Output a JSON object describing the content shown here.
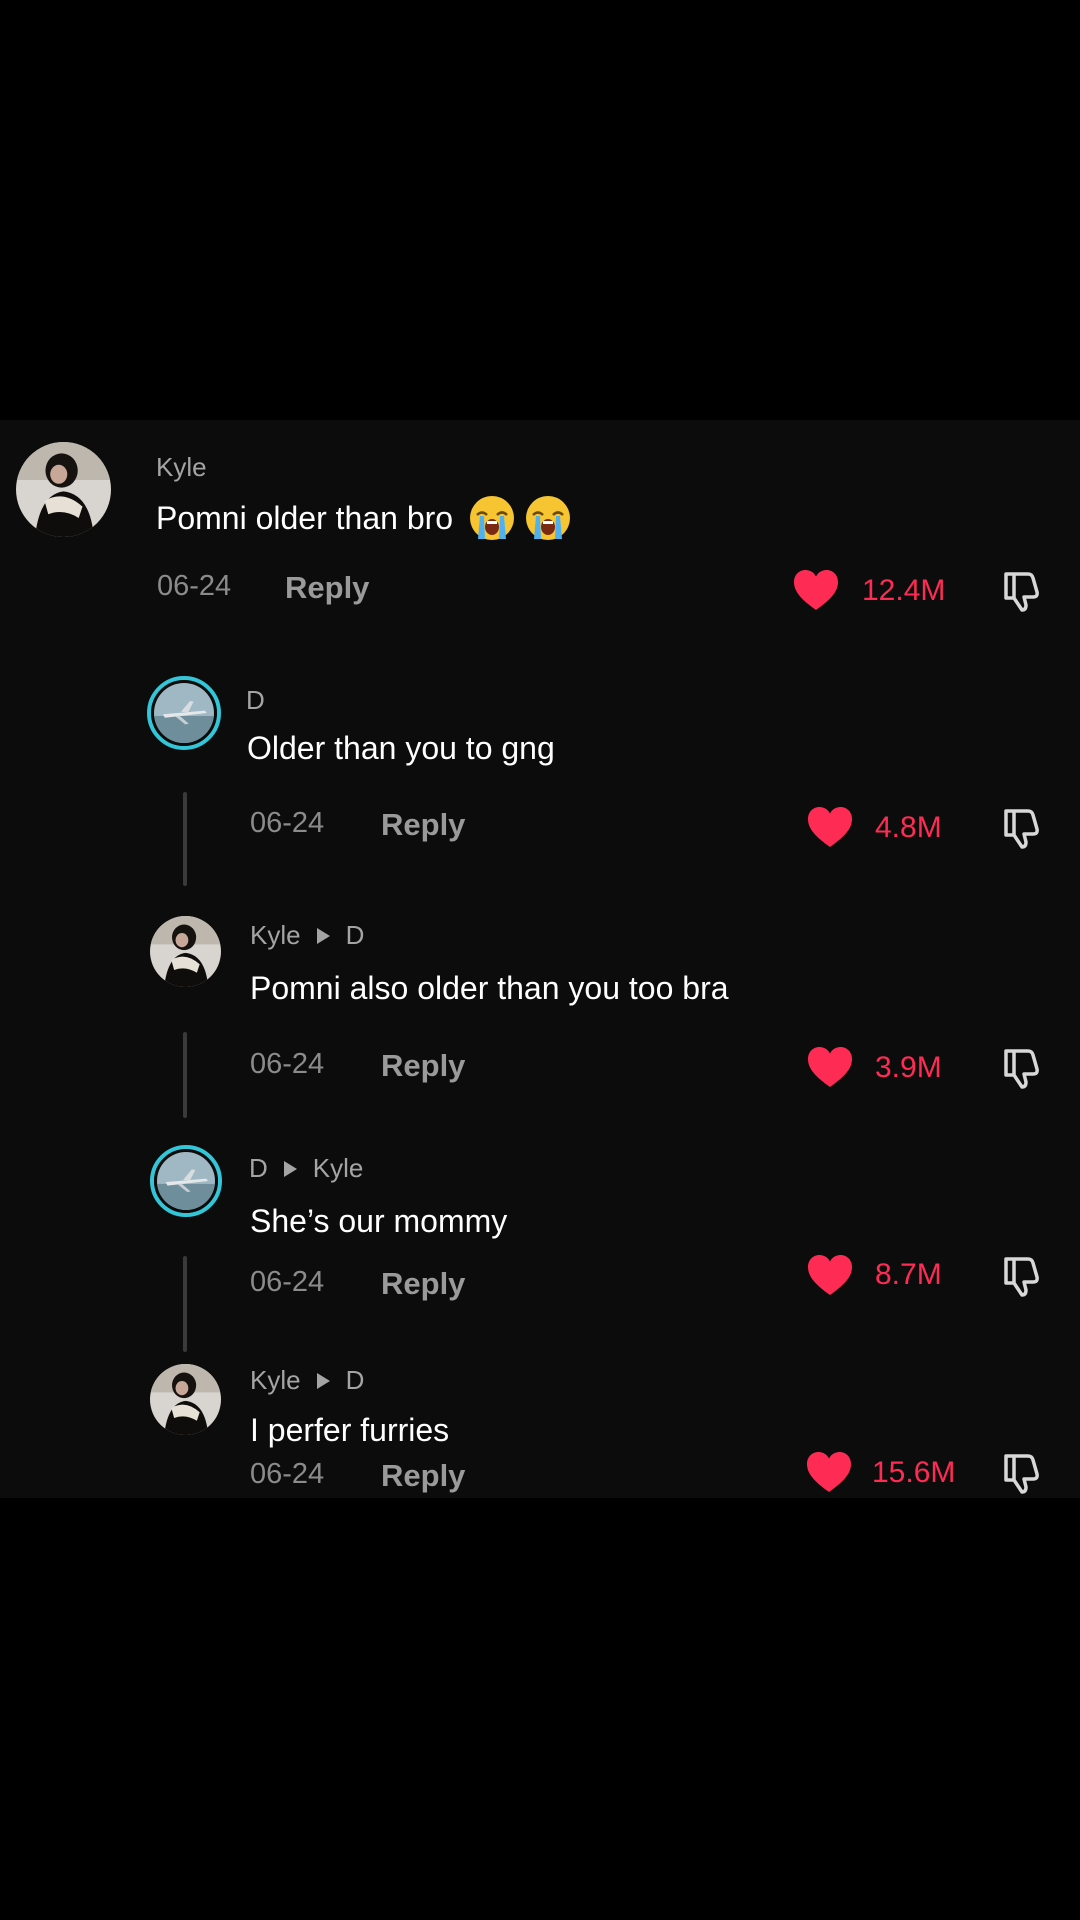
{
  "colors": {
    "like_accent": "#fe2c55",
    "avatar_ring": "#33c6d8",
    "panel_bg": "#0c0c0c"
  },
  "comments": [
    {
      "username": "Kyle",
      "reply_to": "",
      "text": "Pomni older than bro",
      "emoji": [
        "loudly-crying-face-icon",
        "loudly-crying-face-icon"
      ],
      "date": "06-24",
      "reply_label": "Reply",
      "likes": "12.4M",
      "avatar": "kyle-avatar"
    },
    {
      "username": "D",
      "reply_to": "",
      "text": "Older than you to gng",
      "date": "06-24",
      "reply_label": "Reply",
      "likes": "4.8M",
      "avatar": "d-avatar"
    },
    {
      "username": "Kyle",
      "reply_to": "D",
      "text": "Pomni also older than you too bra",
      "date": "06-24",
      "reply_label": "Reply",
      "likes": "3.9M",
      "avatar": "kyle-avatar"
    },
    {
      "username": "D",
      "reply_to": "Kyle",
      "text": "She’s our mommy",
      "date": "06-24",
      "reply_label": "Reply",
      "likes": "8.7M",
      "avatar": "d-avatar"
    },
    {
      "username": "Kyle",
      "reply_to": "D",
      "text": "I perfer furries",
      "date": "06-24",
      "reply_label": "Reply",
      "likes": "15.6M",
      "avatar": "kyle-avatar"
    }
  ]
}
